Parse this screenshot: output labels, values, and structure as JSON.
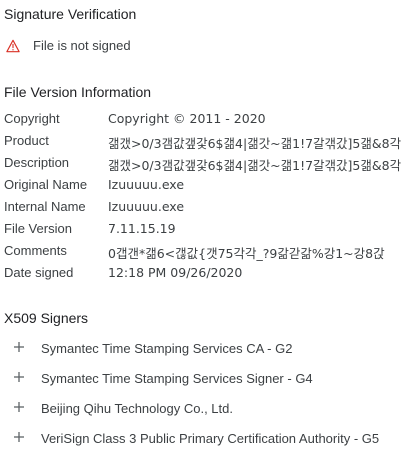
{
  "signature": {
    "title": "Signature Verification",
    "status_icon": "warning-icon",
    "status_text": "File is not signed",
    "status_color": "#d93025"
  },
  "file_version": {
    "title": "File Version Information",
    "rows": [
      {
        "key": "Copyright",
        "value": "Copyright © 2011 - 2020"
      },
      {
        "key": "Product",
        "value": "갦갰>0/3갬값갶갗6$갦4|갦갓~갦1!7갈갞갔]5갦&8각"
      },
      {
        "key": "Description",
        "value": "갦갰>0/3갬값갶갗6$갦4|갦갓~갦1!7갈갞갔]5갦&8각"
      },
      {
        "key": "Original Name",
        "value": "Izuuuuu.exe"
      },
      {
        "key": "Internal Name",
        "value": "Izuuuuu.exe"
      },
      {
        "key": "File Version",
        "value": "7.11.15.19"
      },
      {
        "key": "Comments",
        "value": "0갭갠*갦6<갢값{갯75각각_?9갊갇갊%강1~강8갅"
      },
      {
        "key": "Date signed",
        "value": "12:18 PM 09/26/2020"
      }
    ]
  },
  "x509": {
    "title": "X509 Signers",
    "expand_icon": "plus-icon",
    "signers": [
      {
        "label": "Symantec Time Stamping Services CA - G2"
      },
      {
        "label": "Symantec Time Stamping Services Signer - G4"
      },
      {
        "label": "Beijing Qihu Technology Co., Ltd."
      },
      {
        "label": "VeriSign Class 3 Public Primary Certification Authority - G5"
      }
    ]
  }
}
